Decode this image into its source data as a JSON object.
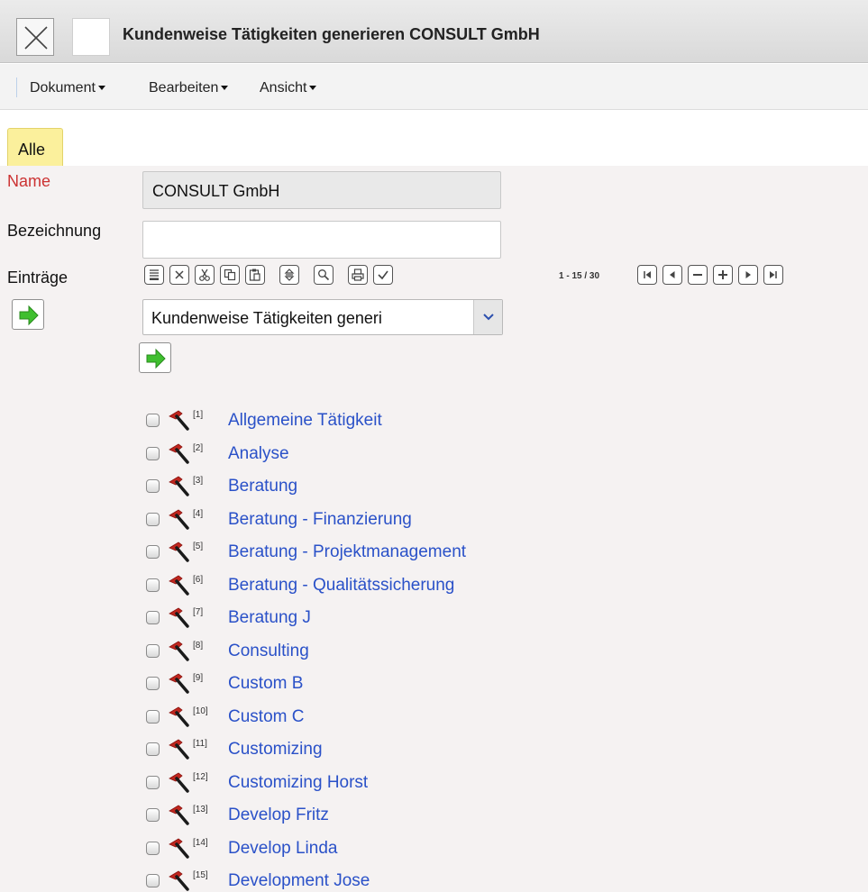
{
  "window": {
    "title": "Kundenweise Tätigkeiten generieren CONSULT GmbH"
  },
  "menu": {
    "items": [
      {
        "label": "Dokument"
      },
      {
        "label": "Bearbeiten"
      },
      {
        "label": "Ansicht"
      }
    ]
  },
  "tabs": [
    {
      "label": "Alle",
      "active": true
    }
  ],
  "form": {
    "name_label": "Name",
    "name_value": "CONSULT GmbH",
    "bez_label": "Bezeichnung",
    "bez_value": "",
    "entries_label": "Einträge"
  },
  "toolbar": {
    "icons": [
      "list-icon",
      "delete-icon",
      "cut-icon",
      "copy-icon",
      "paste-icon",
      "sort-icon",
      "search-icon",
      "print-icon",
      "check-icon"
    ],
    "pager": "1 - 15 / 30",
    "nav_icons": [
      "first-page-icon",
      "prev-page-icon",
      "remove-icon",
      "add-icon",
      "next-page-icon",
      "last-page-icon"
    ]
  },
  "select": {
    "value": "Kundenweise Tätigkeiten generi"
  },
  "colors": {
    "link": "#2a51c8",
    "required_label": "#cc3333",
    "tab_active": "#fbf09c",
    "arrow_green": "#3fbf2f"
  },
  "entries": [
    {
      "index": "[1]",
      "label": "Allgemeine Tätigkeit"
    },
    {
      "index": "[2]",
      "label": "Analyse"
    },
    {
      "index": "[3]",
      "label": "Beratung"
    },
    {
      "index": "[4]",
      "label": "Beratung - Finanzierung"
    },
    {
      "index": "[5]",
      "label": "Beratung - Projektmanagement"
    },
    {
      "index": "[6]",
      "label": "Beratung - Qualitätssicherung"
    },
    {
      "index": "[7]",
      "label": "Beratung J"
    },
    {
      "index": "[8]",
      "label": "Consulting"
    },
    {
      "index": "[9]",
      "label": "Custom B"
    },
    {
      "index": "[10]",
      "label": "Custom C"
    },
    {
      "index": "[11]",
      "label": "Customizing"
    },
    {
      "index": "[12]",
      "label": "Customizing Horst"
    },
    {
      "index": "[13]",
      "label": "Develop Fritz"
    },
    {
      "index": "[14]",
      "label": "Develop Linda"
    },
    {
      "index": "[15]",
      "label": "Development Jose"
    }
  ]
}
